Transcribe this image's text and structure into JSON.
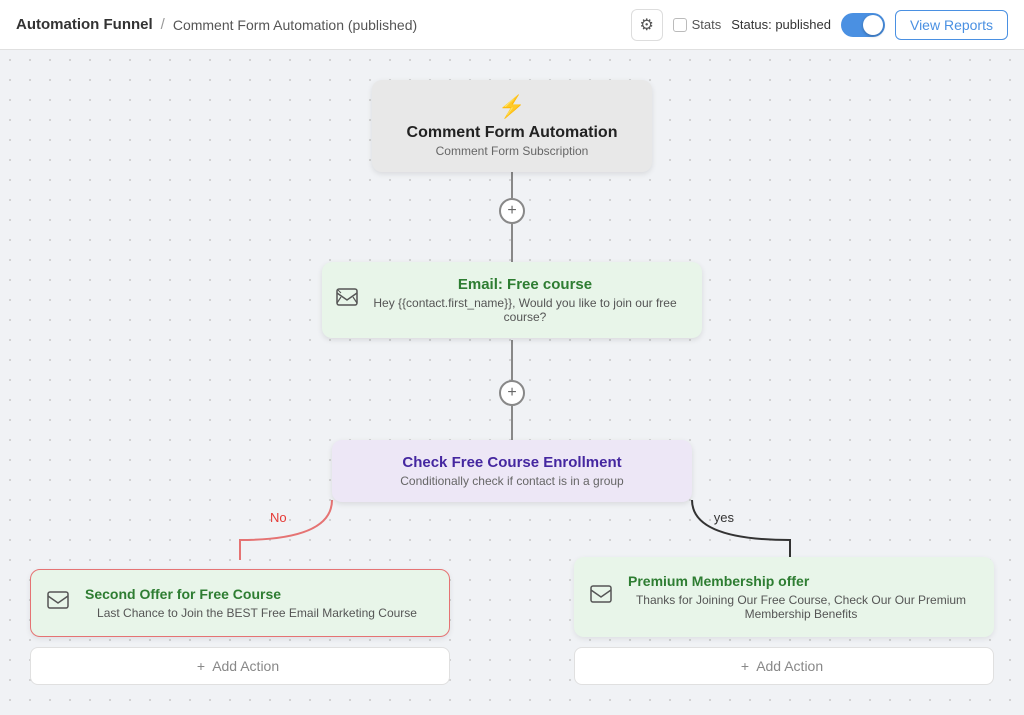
{
  "header": {
    "breadcrumb_root": "Automation Funnel",
    "breadcrumb_sep": "/",
    "breadcrumb_current": "Comment Form Automation (published)",
    "stats_label": "Stats",
    "status_label": "Status: published",
    "view_reports_label": "View Reports"
  },
  "canvas": {
    "trigger_node": {
      "icon": "⚡",
      "title": "Comment Form Automation",
      "subtitle": "Comment Form Subscription"
    },
    "email_node": {
      "title": "Email: Free course",
      "subtitle": "Hey {{contact.first_name}}, Would you like to join our free course?"
    },
    "condition_node": {
      "title": "Check Free Course Enrollment",
      "subtitle": "Conditionally check if contact is in a group"
    },
    "branch_left": {
      "label": "No",
      "card_title": "Second Offer for Free Course",
      "card_subtitle": "Last Chance to Join the BEST Free Email Marketing Course",
      "add_action_label": "Add Action"
    },
    "branch_right": {
      "label": "yes",
      "card_title": "Premium Membership offer",
      "card_subtitle": "Thanks for Joining Our Free Course, Check Our Our Premium Membership Benefits",
      "add_action_label": "Add Action"
    }
  }
}
